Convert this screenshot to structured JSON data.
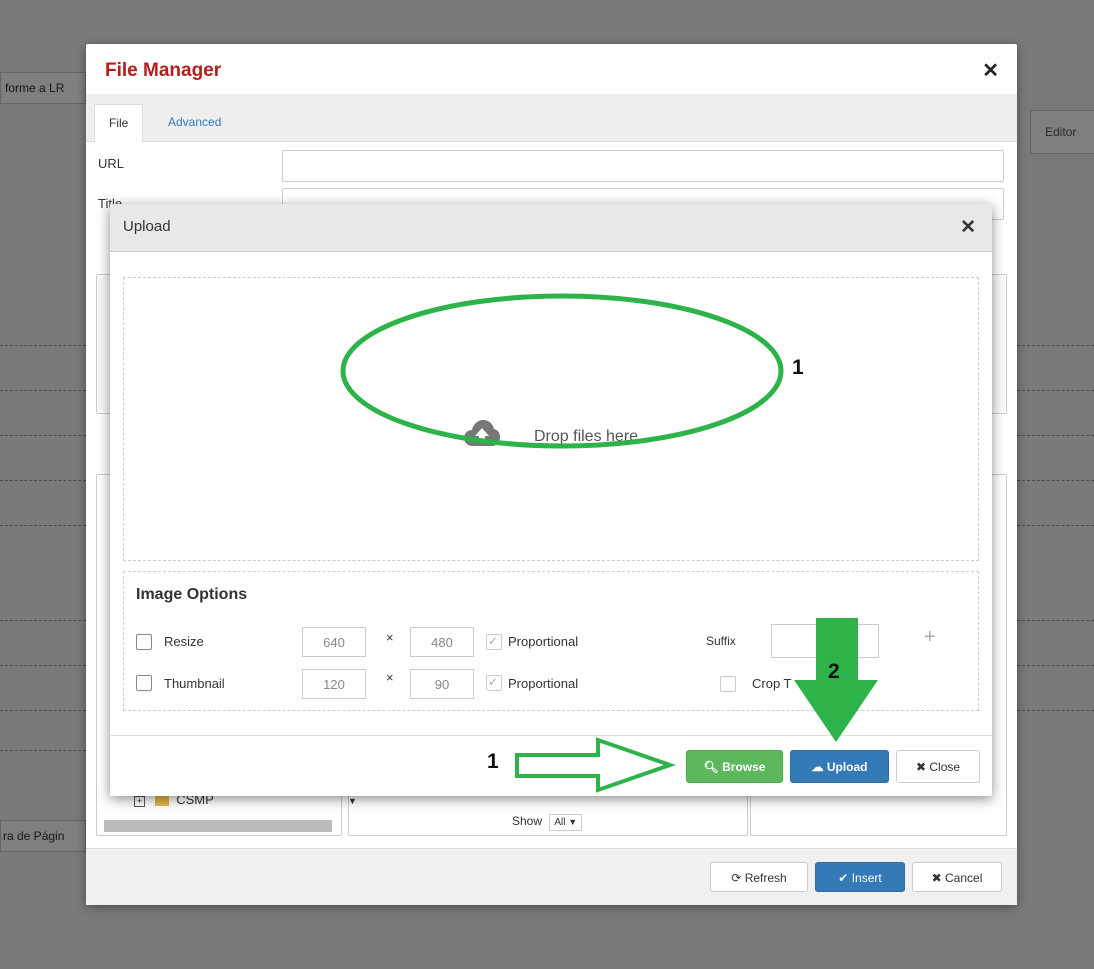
{
  "background": {
    "top_left_text": "forme a LR",
    "editor_tab": "Editor",
    "bottom_left_text": "ra de Págin"
  },
  "file_manager": {
    "title": "File Manager",
    "tabs": [
      {
        "label": "File"
      },
      {
        "label": "Advanced"
      }
    ],
    "url_label": "URL",
    "title_label": "Title",
    "tree_item": "CSMP",
    "show_label": "Show",
    "show_value": "All",
    "refresh_label": "Refresh",
    "insert_label": "Insert",
    "cancel_label": "Cancel"
  },
  "upload_dialog": {
    "title": "Upload",
    "drop_text": "Drop files here",
    "image_options_title": "Image Options",
    "resize": {
      "label": "Resize",
      "width": "640",
      "height": "480",
      "proportional_label": "Proportional"
    },
    "thumbnail": {
      "label": "Thumbnail",
      "width": "120",
      "height": "90",
      "proportional_label": "Proportional"
    },
    "suffix_label": "Suffix",
    "crop_label": "Crop T",
    "times_symbol": "×",
    "browse_label": "Browse",
    "upload_label": "Upload",
    "close_label": "Close"
  },
  "annotations": {
    "label_drop": "1",
    "label_browse": "1",
    "label_upload": "2",
    "color": "#2db34a"
  },
  "colors": {
    "title_red": "#b71c1c",
    "primary": "#337ab7",
    "success": "#5cb85c"
  }
}
